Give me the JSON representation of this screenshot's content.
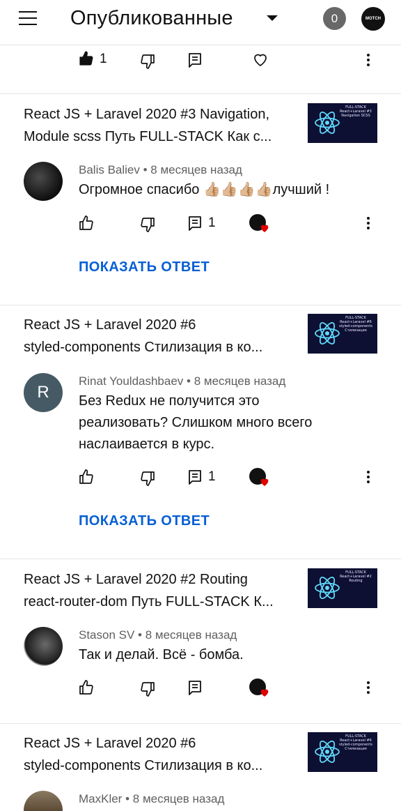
{
  "header": {
    "title": "Опубликованные",
    "notification_count": "0",
    "channel_avatar_text": "MOTCH"
  },
  "top_actions": {
    "like_count": "1"
  },
  "comments": [
    {
      "video_title_line1": "React JS + Laravel 2020 #3 Navigation,",
      "video_title_line2": "Module scss Путь FULL-STACK Как с...",
      "thumbnail_text": "FULL-STACK React+Laravel #3 Navigation SCSS",
      "author": "Balis Baliev",
      "time": "8 месяцев назад",
      "text": "Огромное спасибо 👍🏼👍🏼👍🏼👍🏼лучший !",
      "reply_count": "1",
      "show_reply_label": "ПОКАЗАТЬ ОТВЕТ"
    },
    {
      "video_title_line1": "React JS + Laravel 2020 #6",
      "video_title_line2": "styled-components Стилизация в ко...",
      "thumbnail_text": "FULL-STACK React+Laravel #6 styled-components Стилизация",
      "author": "Rinat Youldashbaev",
      "avatar_letter": "R",
      "time": "8 месяцев назад",
      "text_line1": "Без Redux не получится это",
      "text_line2": "реализовать? Слишком много всего",
      "text_line3": "наслаивается в курс.",
      "reply_count": "1",
      "show_reply_label": "ПОКАЗАТЬ ОТВЕТ"
    },
    {
      "video_title_line1": "React JS + Laravel 2020 #2 Routing",
      "video_title_line2": "react-router-dom Путь FULL-STACK К...",
      "thumbnail_text": "FULL-STACK React+Laravel #2 Routing",
      "author": "Stason SV",
      "time": "8 месяцев назад",
      "text": "Так и делай. Всё  -  бомба."
    },
    {
      "video_title_line1": "React JS + Laravel 2020 #6",
      "video_title_line2": "styled-components Стилизация в ко...",
      "thumbnail_text": "FULL-STACK React+Laravel #6 styled-components Стилизация",
      "author": "MaxKler",
      "time": "8 месяцев назад"
    }
  ],
  "colors": {
    "link_blue": "#065fd4",
    "heart_red": "#e00000",
    "badge_gray": "#686868"
  }
}
